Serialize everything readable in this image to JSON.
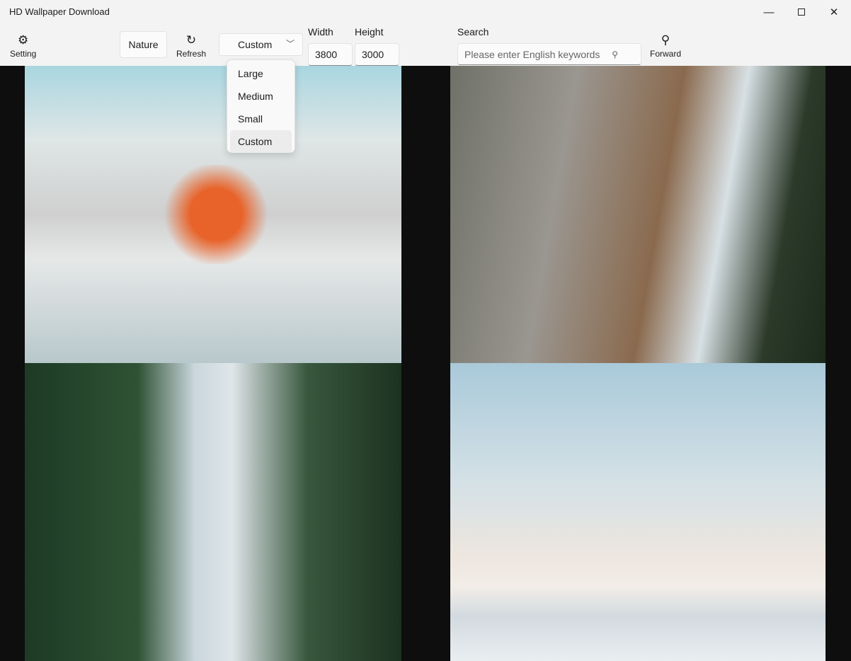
{
  "window": {
    "title": "HD Wallpaper Download",
    "minimize_icon": "minimize-icon",
    "maximize_icon": "maximize-icon",
    "close_icon": "close-icon"
  },
  "toolbar": {
    "setting_label": "Setting",
    "setting_icon": "gear-icon",
    "category_label": "Nature",
    "refresh_label": "Refresh",
    "refresh_icon": "refresh-icon",
    "size_select": {
      "value": "Custom",
      "options": [
        "Large",
        "Medium",
        "Small",
        "Custom"
      ]
    },
    "width_label": "Width",
    "width_value": "3800",
    "height_label": "Height",
    "height_value": "3000",
    "search_label": "Search",
    "search_placeholder": "Please enter English keywords",
    "forward_label": "Forward",
    "forward_icon": "search-icon"
  },
  "gallery": {
    "images": [
      {
        "subject": "orange leaves over misty lake"
      },
      {
        "subject": "waterfall canyon cliffs"
      },
      {
        "subject": "forest river reflection"
      },
      {
        "subject": "sea of clouds with peak"
      }
    ]
  }
}
